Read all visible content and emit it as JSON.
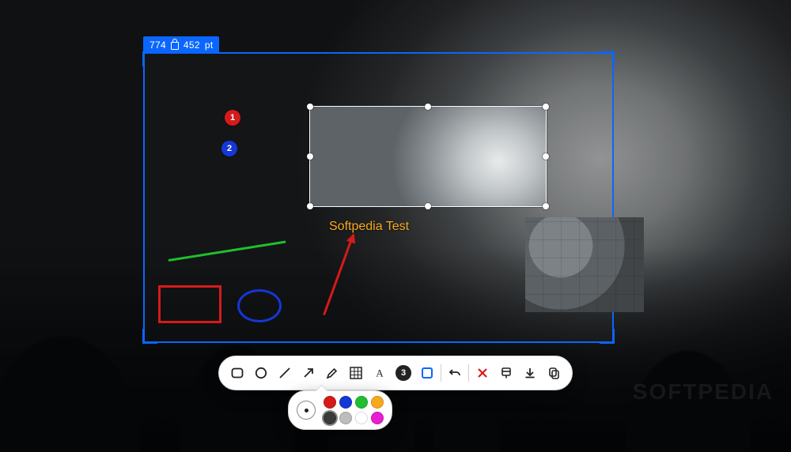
{
  "selection": {
    "width": "774",
    "height": "452",
    "unit": "pt"
  },
  "annotations": {
    "number_1": "1",
    "number_2": "2",
    "text_label": "Softpedia Test"
  },
  "toolbar": {
    "counter_value": "3"
  },
  "colors": {
    "accent_blue": "#0a66ff",
    "anno_red": "#d61a1a",
    "anno_blue": "#1537d6",
    "anno_green": "#1fbf2f",
    "text_orange": "#f6a91b",
    "swatches_row1": [
      "#d61a1a",
      "#1537d6",
      "#1fbf2f",
      "#f6a91b"
    ],
    "swatches_row2": [
      "#3a3a3a",
      "#bdbdbd",
      "#ffffff",
      "#e81ed0"
    ]
  },
  "watermark": "SOFTPEDIA"
}
